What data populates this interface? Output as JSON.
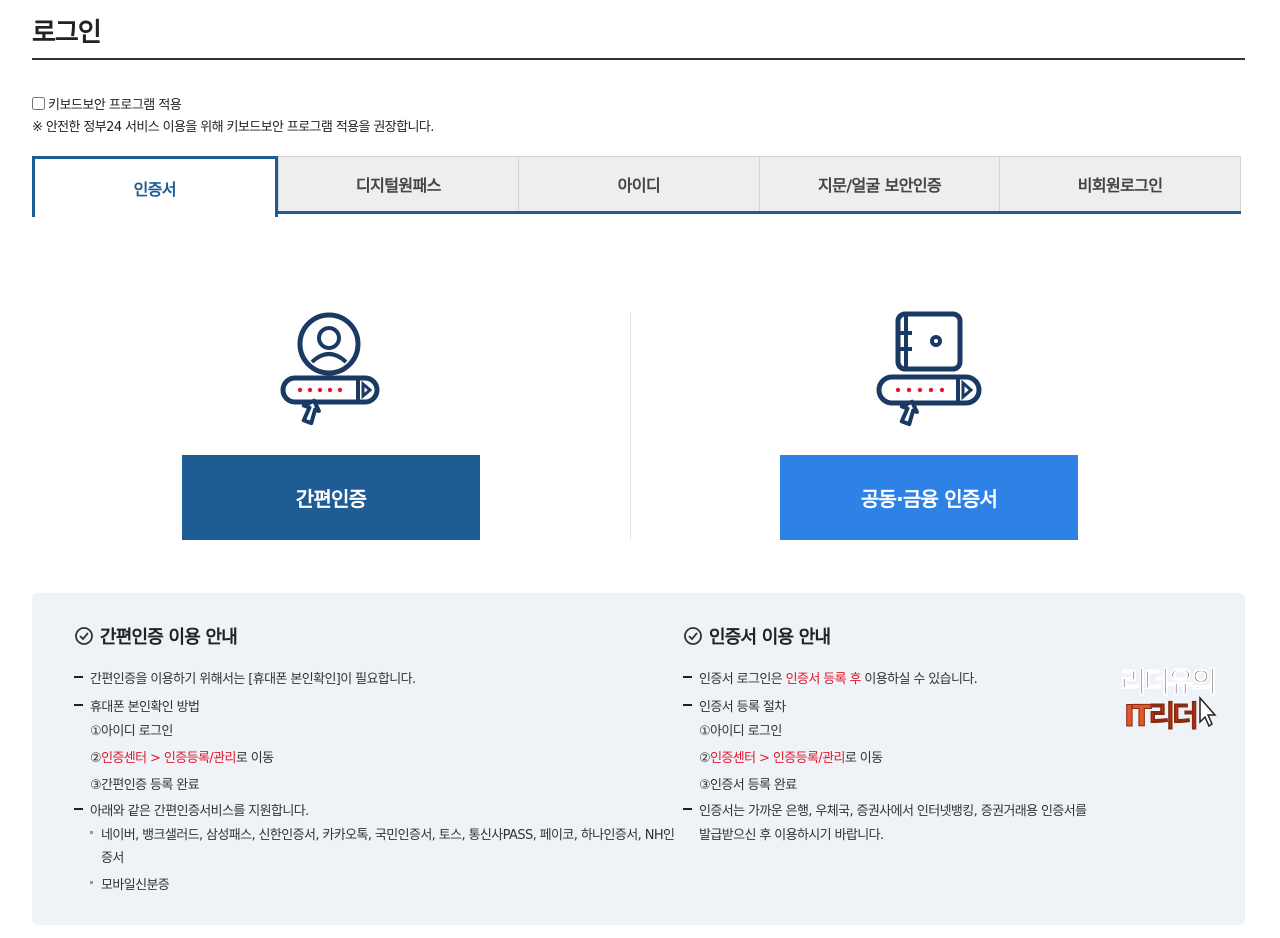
{
  "page": {
    "title": "로그인"
  },
  "keyboard_security": {
    "checkbox_label": "키보드보안 프로그램 적용",
    "checked": false,
    "note": "※ 안전한 정부24 서비스 이용을 위해 키보드보안 프로그램 적용을 권장합니다."
  },
  "tabs": [
    {
      "label": "인증서",
      "active": true
    },
    {
      "label": "디지털원패스",
      "active": false
    },
    {
      "label": "아이디",
      "active": false
    },
    {
      "label": "지문/얼굴 보안인증",
      "active": false
    },
    {
      "label": "비회원로그인",
      "active": false
    }
  ],
  "login_options": {
    "simple_auth_button": "간편인증",
    "certificate_button": "공동·금융 인증서"
  },
  "guide": {
    "simple": {
      "title": "간편인증 이용 안내",
      "line1": "간편인증을 이용하기 위해서는 [휴대폰 본인확인]이 필요합니다.",
      "line2": "휴대폰 본인확인 방법",
      "step1": "①아이디 로그인",
      "step2_prefix": "②",
      "step2_red": "인증센터 > 인증등록/관리",
      "step2_suffix": "로 이동",
      "step3": "③간편인증 등록 완료",
      "line3": "아래와 같은 간편인증서비스를 지원합니다.",
      "sub1a": "네이버, 뱅크샐러드, 삼성패스, 신한인증서, 카카오톡, 국민인증서, 토스, 통신사PASS, 페이코, 하나인증서, NH인",
      "sub1b": "증서",
      "sub2": "모바일신분증"
    },
    "cert": {
      "title": "인증서 이용 안내",
      "line1_prefix": "인증서 로그인은 ",
      "line1_red": "인증서 등록 후",
      "line1_suffix": " 이용하실 수 있습니다.",
      "line2": "인증서 등록 절차",
      "step1": "①아이디 로그인",
      "step2_prefix": "②",
      "step2_red": "인증센터 > 인증등록/관리",
      "step2_suffix": "로 이동",
      "step3": "③인증서 등록 완료",
      "line3a": "인증서는 가까운 은행, 우체국, 증권사에서 인터넷뱅킹, 증권거래용 인증서를",
      "line3b": "발급받으신 후 이용하시기 바랍니다."
    }
  },
  "badge": {
    "line1": "리더유의",
    "line2": "IT리더"
  },
  "colors": {
    "primary": "#1f5c94",
    "accent": "#2f82e5",
    "highlight": "#e0192b",
    "guide_bg": "#eff3f7"
  }
}
